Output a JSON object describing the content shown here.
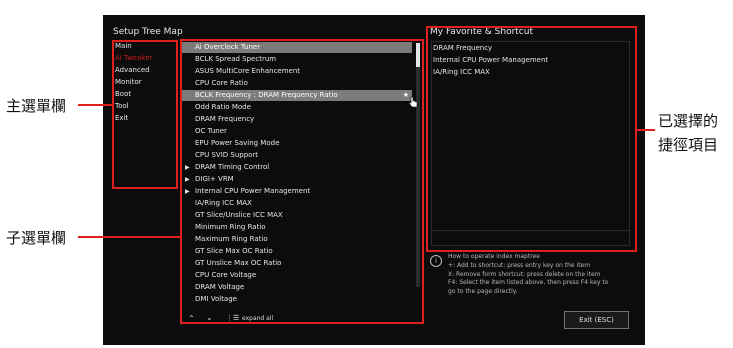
{
  "tree_map": {
    "title": "Setup Tree Map",
    "main_menu": [
      "Main",
      "Ai Tweaker",
      "Advanced",
      "Monitor",
      "Boot",
      "Tool",
      "Exit"
    ],
    "active_index": 1,
    "submenu": [
      {
        "label": "Ai Overclock Tuner",
        "arrow": false
      },
      {
        "label": "BCLK Spread Spectrum",
        "arrow": false
      },
      {
        "label": "ASUS MultiCore Enhancement",
        "arrow": false
      },
      {
        "label": "CPU Core Ratio",
        "arrow": false
      },
      {
        "label": "BCLK Frequency : DRAM Frequency Ratio",
        "arrow": false
      },
      {
        "label": "Odd Ratio Mode",
        "arrow": false
      },
      {
        "label": "DRAM Frequency",
        "arrow": false
      },
      {
        "label": "OC Tuner",
        "arrow": false
      },
      {
        "label": "EPU Power Saving Mode",
        "arrow": false
      },
      {
        "label": "CPU SVID Support",
        "arrow": false
      },
      {
        "label": "DRAM Timing Control",
        "arrow": true
      },
      {
        "label": "DIGI+ VRM",
        "arrow": true
      },
      {
        "label": "Internal CPU Power Management",
        "arrow": true
      },
      {
        "label": "IA/Ring ICC MAX",
        "arrow": false
      },
      {
        "label": "GT Slice/Unslice ICC MAX",
        "arrow": false
      },
      {
        "label": "Minimum Ring Ratio",
        "arrow": false
      },
      {
        "label": "Maximum Ring Ratio",
        "arrow": false
      },
      {
        "label": "GT Slice Max OC Ratio",
        "arrow": false
      },
      {
        "label": "GT Unslice Max OC Ratio",
        "arrow": false
      },
      {
        "label": "CPU Core Voltage",
        "arrow": false
      },
      {
        "label": "DRAM Voltage",
        "arrow": false
      },
      {
        "label": "DMI Voltage",
        "arrow": false
      }
    ],
    "highlight_indices": [
      0,
      4
    ],
    "expand_label": "expand all"
  },
  "favorites": {
    "title": "My Favorite & Shortcut",
    "items": [
      "DRAM Frequency",
      "Internal CPU Power Management",
      "IA/Ring ICC MAX"
    ]
  },
  "help": {
    "title": "How to operate index maptree",
    "lines": [
      "+: Add to shortcut: press entry key on the item",
      "X: Remove form shortcut: press delete on the item",
      "F4: Select the item listed above, then press F4 key to",
      "go to the page directly."
    ]
  },
  "exit_button": "Exit (ESC)",
  "annotations": {
    "main_menu_bar": "主選單欄",
    "submenu_bar": "子選單欄",
    "selected_shortcut_line1": "已選擇的",
    "selected_shortcut_line2": "捷徑項目"
  },
  "colors": {
    "accent_red": "#e0201e",
    "active_menu": "#c41e1e",
    "highlight_row": "#7b7b7b",
    "screen_bg": "#0c0c0c"
  }
}
